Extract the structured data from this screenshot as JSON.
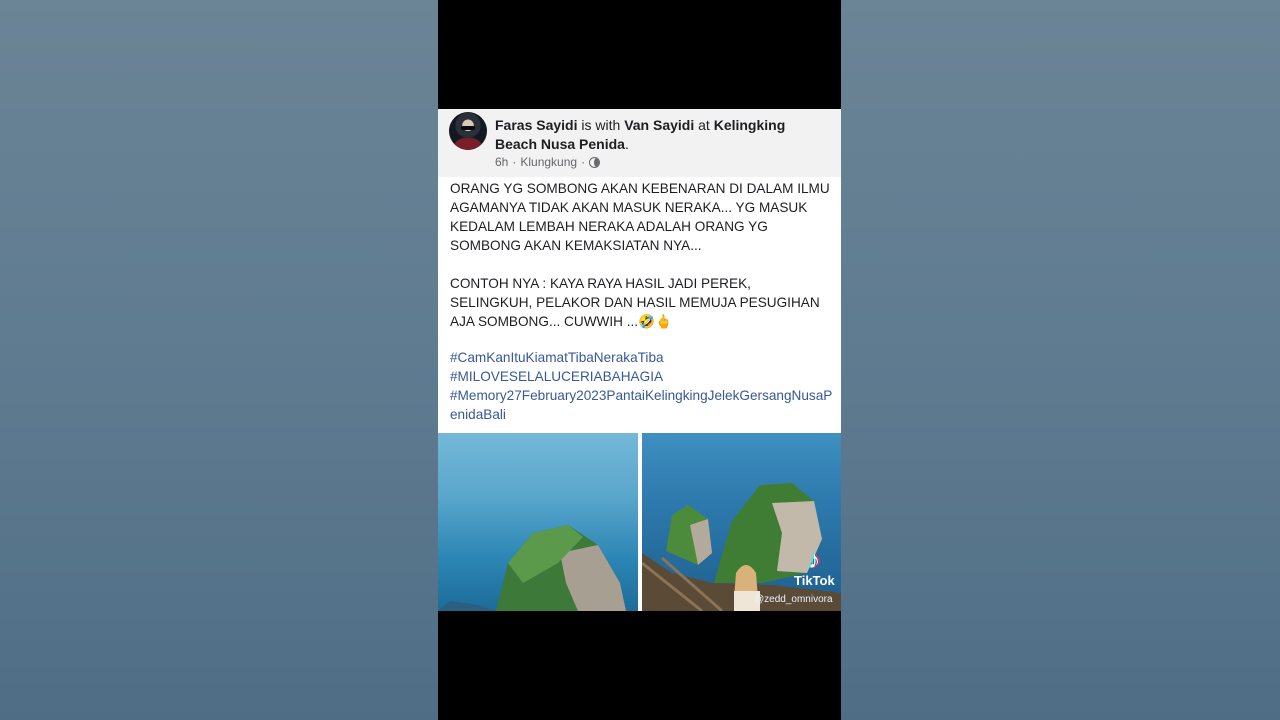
{
  "post": {
    "author": "Faras Sayidi",
    "with_text": "is with",
    "tagged": "Van Sayidi",
    "at_text": "at",
    "location": "Kelingking Beach Nusa Penida",
    "period": ".",
    "time": "6h",
    "sep1": "·",
    "place": "Klungkung",
    "sep2": "·",
    "body": "ORANG YG SOMBONG AKAN KEBENARAN DI DALAM ILMU AGAMANYA TIDAK AKAN MASUK NERAKA... YG MASUK KEDALAM LEMBAH NERAKA ADALAH ORANG YG SOMBONG AKAN KEMAKSIATAN NYA...\n\nCONTOH NYA : KAYA RAYA HASIL JADI PEREK, SELINGKUH, PELAKOR DAN HASIL MEMUJA PESUGIHAN AJA SOMBONG... CUWWIH ...🤣🖕",
    "hashtags": [
      "#CamKanItuKiamatTibaNerakaTiba",
      "#MILOVESELALUCERIABAHAGIA",
      "#Memory27February2023PantaiKelingkingJelekGersangNusaPenidaBali"
    ]
  },
  "overlay": {
    "brand": "TikTok",
    "handle": "@zedd_omnivora"
  },
  "icons": {
    "visibility": "globe-icon",
    "brand": "tiktok-icon"
  }
}
